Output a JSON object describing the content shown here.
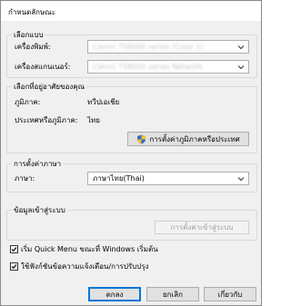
{
  "window": {
    "title": "กำหนดลักษณะ"
  },
  "select_device": {
    "group_label": "เลือกแบบ",
    "printer_label": "เครื่องพิมพ์:",
    "printer_value": "Canon TS8000 series (Copy 1)",
    "scanner_label": "เครื่องสแกนเนอร์:",
    "scanner_value": "Canon TS8000 series Network"
  },
  "region": {
    "group_label": "เลือกที่อยู่อาศัยของคุณ",
    "region_label": "ภูมิภาค:",
    "region_value": "ทวีปเอเชีย",
    "country_label": "ประเทศหรือภูมิภาค:",
    "country_value": "ไทย",
    "settings_button": "การตั้งค่าภูมิภาคหรือประเทศ"
  },
  "language": {
    "group_label": "การตั้งค่าภาษา",
    "language_label": "ภาษา:",
    "language_value": "ภาษาไทย(Thai)"
  },
  "login": {
    "group_label": "ข้อมูลเข้าสู่ระบบ",
    "settings_button": "การตั้งค่าเข้าสู่ระบบ"
  },
  "options": {
    "startup_label": "เริ่ม Quick Menu ขณะที่ Windows เริ่มต้น",
    "startup_checked": true,
    "notify_label": "ใช้ฟังก์ชันข้อความแจ้งเตือน/การปรับปรุง",
    "notify_checked": true
  },
  "footer": {
    "ok": "ตกลง",
    "cancel": "ยกเลิก",
    "help": "เกี่ยวกับ"
  },
  "colors": {
    "accent": "#0078d7",
    "check": "#000000"
  }
}
